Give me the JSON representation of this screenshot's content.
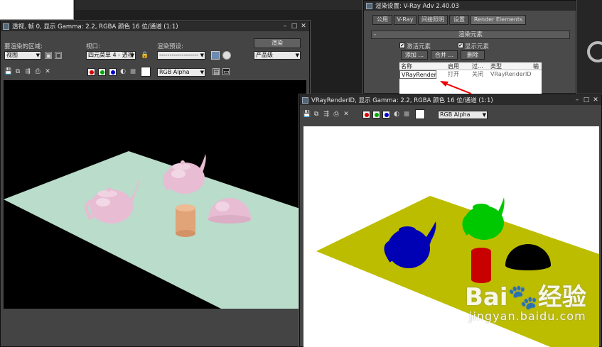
{
  "left_window": {
    "title": "透视, 帧 0, 显示 Gamma: 2.2, RGBA 颜色 16 位/通道 (1:1)",
    "area_label": "要渲染的区域:",
    "area_value": "视图",
    "viewport_label": "视口:",
    "viewport_value": "四元菜单 4 - 透视",
    "preset_label": "渲染预设:",
    "preset_value": "-------------------",
    "render_button": "渲染",
    "quality_value": "产品级",
    "channel_value": "RGB Alpha"
  },
  "right_window": {
    "title": "VRayRenderID, 显示 Gamma: 2.2, RGBA 颜色 16 位/通道 (1:1)",
    "channel_value": "RGB Alpha"
  },
  "vray_panel": {
    "title": "渲染设置: V-Ray Adv 2.40.03",
    "tabs": [
      "公用",
      "V-Ray",
      "间接照明",
      "设置",
      "Render Elements"
    ],
    "rollout_title": "渲染元素",
    "active_elements_label": "激活元素",
    "display_elements_label": "显示元素",
    "add_button": "添加 ...",
    "merge_button": "合并 ...",
    "delete_button": "删除",
    "columns": [
      "名称",
      "启用",
      "过...",
      "类型",
      "输"
    ],
    "row": {
      "name": "VRayRenderID",
      "enabled": "打开",
      "filter": "关闭",
      "type": "VRayRenderID"
    }
  },
  "colors": {
    "ground_left": "#b9dccb",
    "ground_right": "#bdbd00",
    "teapot_pink": "#e8bcd3",
    "cylinder": "#e0a478",
    "id_blue": "#0000b4",
    "id_green": "#00c800",
    "id_red": "#c80000",
    "id_black": "#000000"
  },
  "watermark": {
    "brand": "Bai",
    "brand_tail": "经验",
    "url": "jingyan.baidu.com"
  }
}
